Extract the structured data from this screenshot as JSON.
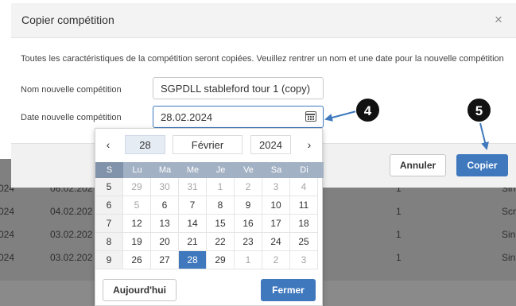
{
  "dialog": {
    "title": "Copier compétition",
    "close_symbol": "×",
    "description": "Toutes les caractéristiques de la compétition seront copiées. Veuillez rentrer un nom et une date pour la nouvelle compétition",
    "name_label": "Nom nouvelle compétition",
    "name_value": "SGPDLL stableford tour 1 (copy)",
    "date_label": "Date nouvelle compétition",
    "date_value": "28.02.2024",
    "cancel_label": "Annuler",
    "copy_label": "Copier"
  },
  "calendar": {
    "prev": "‹",
    "next": "›",
    "day": "28",
    "month": "Février",
    "year": "2024",
    "weekday_headers": [
      "S",
      "Lu",
      "Ma",
      "Me",
      "Je",
      "Ve",
      "Sa",
      "Di"
    ],
    "weeks": [
      {
        "week": "5",
        "days": [
          {
            "d": "29",
            "muted": true
          },
          {
            "d": "30",
            "muted": true
          },
          {
            "d": "31",
            "muted": true
          },
          {
            "d": "1",
            "muted": true
          },
          {
            "d": "2",
            "muted": true
          },
          {
            "d": "3",
            "muted": true
          },
          {
            "d": "4",
            "muted": true
          }
        ]
      },
      {
        "week": "6",
        "days": [
          {
            "d": "5",
            "muted": true
          },
          {
            "d": "6"
          },
          {
            "d": "7"
          },
          {
            "d": "8"
          },
          {
            "d": "9"
          },
          {
            "d": "10"
          },
          {
            "d": "11"
          }
        ]
      },
      {
        "week": "7",
        "days": [
          {
            "d": "12"
          },
          {
            "d": "13"
          },
          {
            "d": "14"
          },
          {
            "d": "15"
          },
          {
            "d": "16"
          },
          {
            "d": "17"
          },
          {
            "d": "18"
          }
        ]
      },
      {
        "week": "8",
        "days": [
          {
            "d": "19"
          },
          {
            "d": "20"
          },
          {
            "d": "21"
          },
          {
            "d": "22"
          },
          {
            "d": "23"
          },
          {
            "d": "24"
          },
          {
            "d": "25"
          }
        ]
      },
      {
        "week": "9",
        "days": [
          {
            "d": "26"
          },
          {
            "d": "27"
          },
          {
            "d": "28",
            "selected": true
          },
          {
            "d": "29"
          },
          {
            "d": "1",
            "muted": true
          },
          {
            "d": "2",
            "muted": true
          },
          {
            "d": "3",
            "muted": true
          }
        ]
      }
    ],
    "today_label": "Aujourd'hui",
    "close_label": "Fermer"
  },
  "background_rows": [
    {
      "c1": "024",
      "c2": "06.02.202",
      "c3": "1",
      "c4": "Sin"
    },
    {
      "c1": "024",
      "c2": "04.02.202",
      "c3": "1",
      "c4": "Scr"
    },
    {
      "c1": "024",
      "c2": "03.02.202",
      "c3": "1",
      "c4": "Sin"
    },
    {
      "c1": "024",
      "c2": "03.02.202",
      "c3": "1",
      "c4": "Sin"
    }
  ],
  "annotations": {
    "step4": "4",
    "step5": "5"
  },
  "colors": {
    "accent": "#3f78bd",
    "overlay": "#808080",
    "header_row": "#a3b1c4",
    "week_col": "#8193aa"
  }
}
